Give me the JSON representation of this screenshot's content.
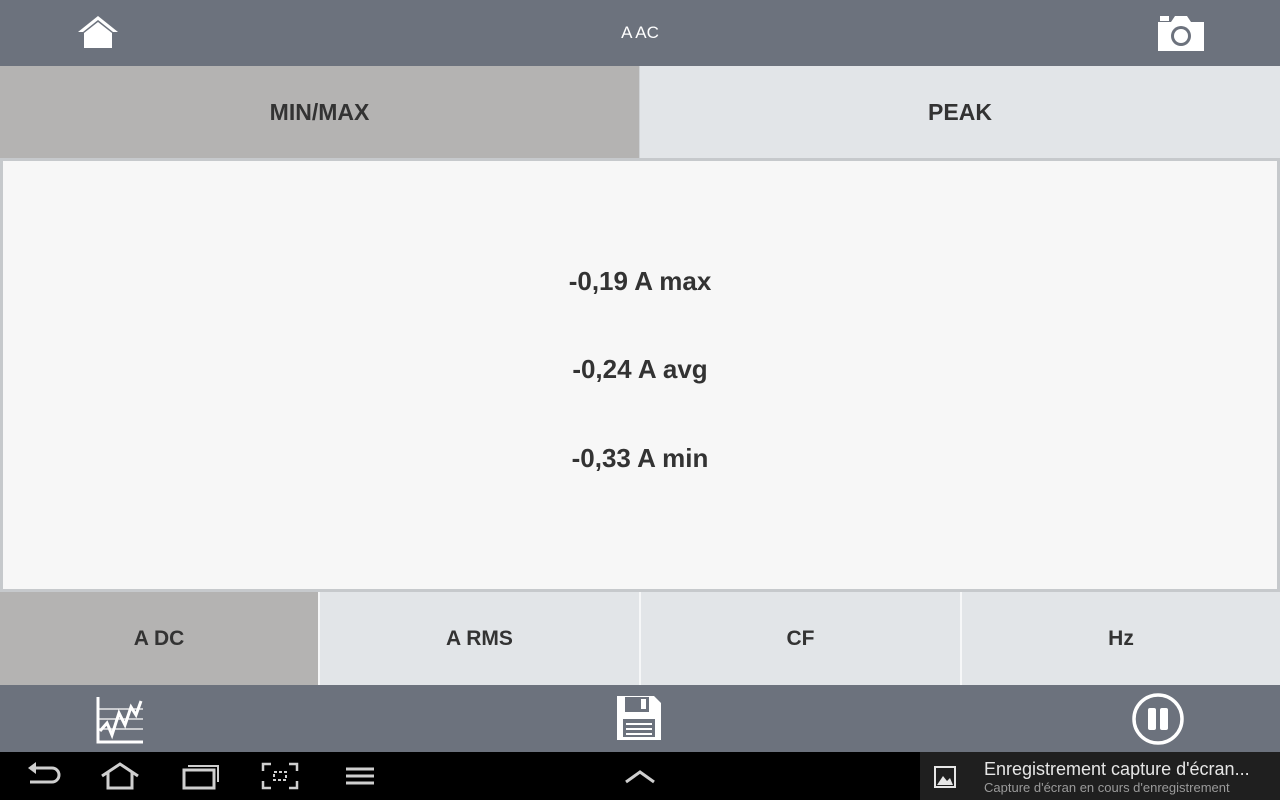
{
  "header": {
    "title": "A AC",
    "home_icon": "home-icon",
    "camera_icon": "camera-icon"
  },
  "mode_tabs": [
    {
      "label": "MIN/MAX",
      "active": true
    },
    {
      "label": "PEAK",
      "active": false
    }
  ],
  "readings": {
    "max": "-0,19 A max",
    "avg": "-0,24 A avg",
    "min": "-0,33 A min"
  },
  "function_tabs": [
    {
      "label": "A DC",
      "active": true
    },
    {
      "label": "A RMS",
      "active": false
    },
    {
      "label": "CF",
      "active": false
    },
    {
      "label": "Hz",
      "active": false
    }
  ],
  "toolbar": {
    "graph_icon": "graph-icon",
    "save_icon": "save-icon",
    "pause_icon": "pause-icon"
  },
  "notification": {
    "title": "Enregistrement capture d'écran...",
    "subtitle": "Capture d'écran en cours d'enregistrement"
  },
  "colors": {
    "bar": "#6c727d",
    "tab_active": "#b4b3b2",
    "tab_inactive": "#e2e5e8",
    "panel": "#f7f7f7",
    "text": "#333333"
  }
}
